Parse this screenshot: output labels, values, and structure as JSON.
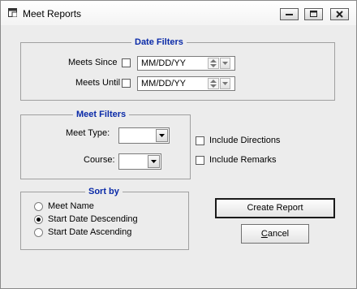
{
  "window": {
    "title": "Meet Reports"
  },
  "icons": {
    "app": "report-window-icon",
    "minimize": "minimize-icon",
    "maximize": "maximize-icon",
    "close": "close-icon"
  },
  "date_filters": {
    "legend": "Date Filters",
    "meets_since": {
      "label": "Meets Since",
      "checked": false,
      "value": "MM/DD/YY"
    },
    "meets_until": {
      "label": "Meets Until",
      "checked": false,
      "value": "MM/DD/YY"
    }
  },
  "meet_filters": {
    "legend": "Meet Filters",
    "meet_type": {
      "label": "Meet Type:",
      "value": ""
    },
    "course": {
      "label": "Course:",
      "value": ""
    }
  },
  "options": {
    "include_directions": {
      "label": "Include Directions",
      "checked": false
    },
    "include_remarks": {
      "label": "Include Remarks",
      "checked": false
    }
  },
  "sort_by": {
    "legend": "Sort by",
    "options": [
      {
        "label": "Meet Name",
        "selected": false
      },
      {
        "label": "Start Date Descending",
        "selected": true
      },
      {
        "label": "Start Date Ascending",
        "selected": false
      }
    ]
  },
  "buttons": {
    "create_report": "Create Report",
    "cancel_prefix": "C",
    "cancel_rest": "ancel"
  },
  "colors": {
    "legend": "#0a2aa8",
    "background": "#ececec"
  }
}
